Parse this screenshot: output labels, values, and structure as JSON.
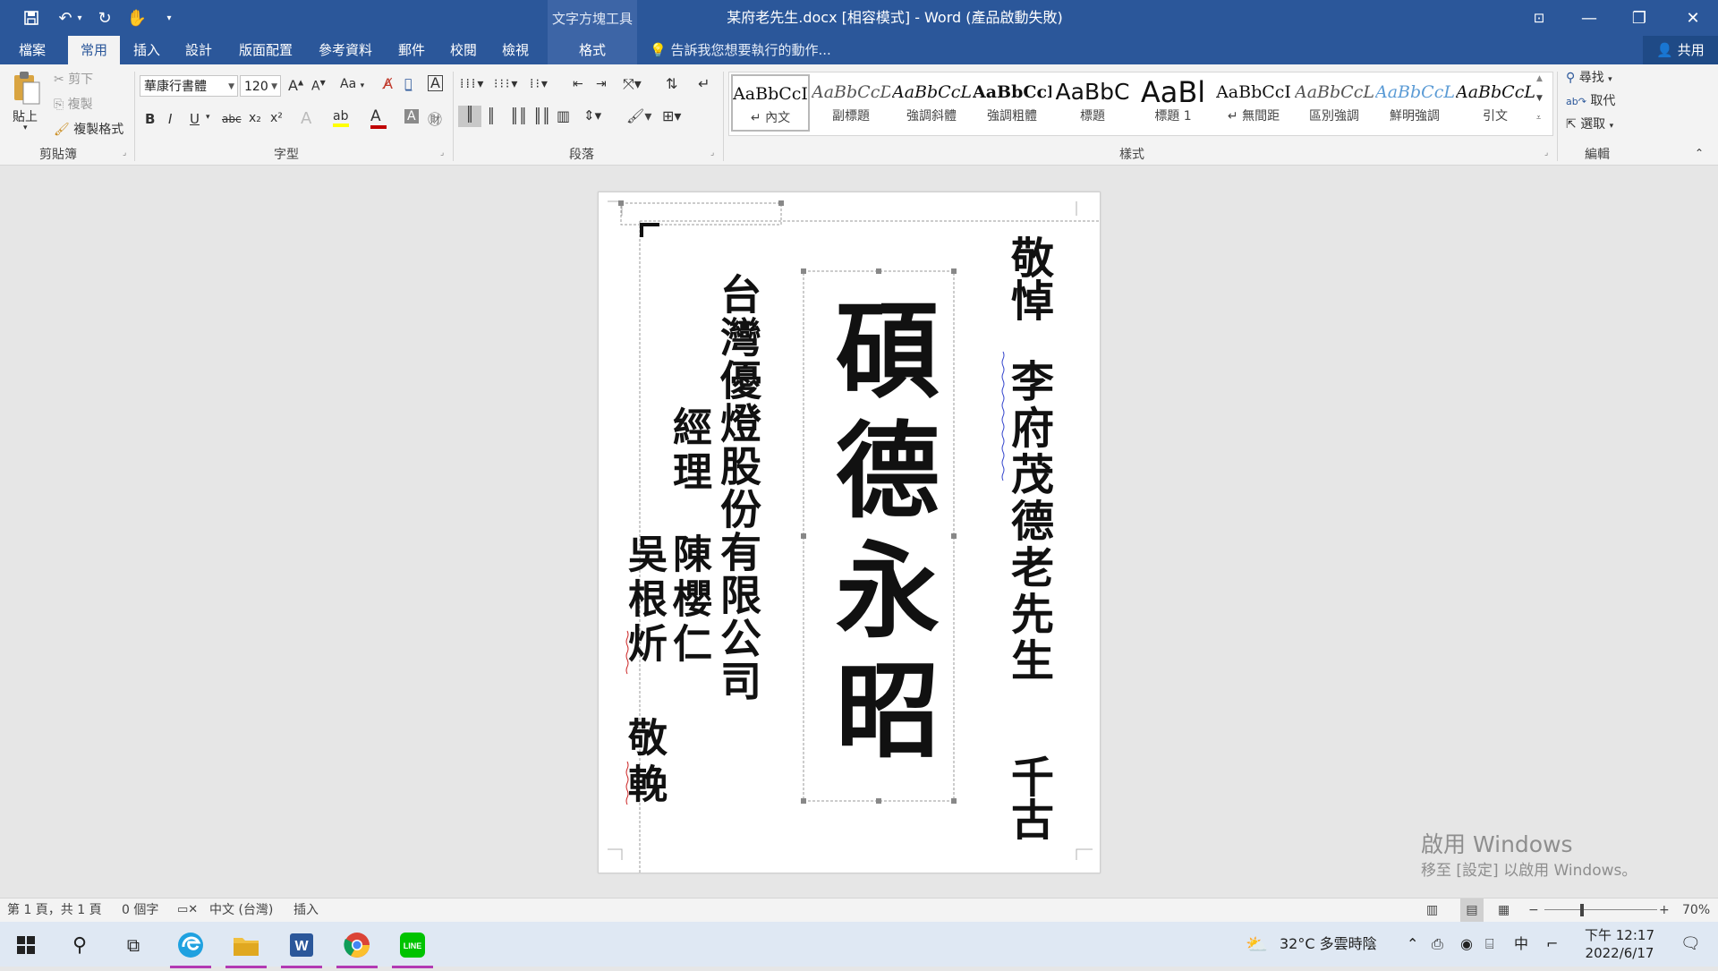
{
  "titlebar": {
    "context_tools_label": "文字方塊工具",
    "doc_title": "某府老先生.docx [相容模式] - Word (產品啟動失敗)",
    "qa_icons": [
      "save-icon",
      "undo-icon",
      "redo-icon",
      "touch-mode-icon",
      "customize-qa-icon"
    ],
    "window_buttons": {
      "ribbon_display": "⊡",
      "minimize": "—",
      "restore": "❐",
      "close": "✕"
    }
  },
  "tabs": [
    {
      "label": "檔案"
    },
    {
      "label": "常用",
      "active": true
    },
    {
      "label": "插入"
    },
    {
      "label": "設計"
    },
    {
      "label": "版面配置"
    },
    {
      "label": "參考資料"
    },
    {
      "label": "郵件"
    },
    {
      "label": "校閱"
    },
    {
      "label": "檢視"
    },
    {
      "label": "格式",
      "contextual": true
    }
  ],
  "tellme": "告訴我您想要執行的動作...",
  "share": "共用",
  "ribbon": {
    "clipboard": {
      "paste": "貼上",
      "cut": "剪下",
      "copy": "複製",
      "format_painter": "複製格式",
      "label": "剪貼簿"
    },
    "font": {
      "name": "華康行書體",
      "size": "120",
      "label": "字型",
      "bold": "B",
      "italic": "I",
      "underline": "U",
      "strike": "abc",
      "sub": "x₂",
      "sup": "x²",
      "change_case": "Aa",
      "grow": "A",
      "shrink": "A"
    },
    "paragraph": {
      "label": "段落"
    },
    "styles": {
      "label": "樣式",
      "items": [
        {
          "sample": "AaBbCcI",
          "name": "↵ 內文",
          "selected": true
        },
        {
          "sample": "AaBbCcDi",
          "name": "副標題"
        },
        {
          "sample": "AaBbCcL",
          "name": "強調斜體"
        },
        {
          "sample": "AaBbCcI",
          "name": "強調粗體"
        },
        {
          "sample": "AaBbC",
          "name": "標題"
        },
        {
          "sample": "AaBl",
          "name": "標題 1"
        },
        {
          "sample": "AaBbCcI",
          "name": "↵ 無間距"
        },
        {
          "sample": "AaBbCcL",
          "name": "區別強調"
        },
        {
          "sample": "AaBbCcL",
          "name": "鮮明強調"
        },
        {
          "sample": "AaBbCcL",
          "name": "引文"
        }
      ]
    },
    "editing": {
      "find": "尋找",
      "replace": "取代",
      "select": "選取",
      "label": "編輯"
    }
  },
  "document": {
    "col_right_top": "敬悼",
    "col_right_main": "李府茂德老先生",
    "col_right_bottom": "千古",
    "center_main": "碩德永昭",
    "col_company": "台灣優燈股份有限公司",
    "col_manager_title": "經理",
    "col_manager_name": "陳櫻仁",
    "col_sender_name": "吳根炘",
    "col_sender_closing": "敬輓"
  },
  "watermark": {
    "line1": "啟用 Windows",
    "line2": "移至 [設定] 以啟用 Windows。"
  },
  "statusbar": {
    "page": "第 1 頁，共 1 頁",
    "words": "0 個字",
    "language": "中文 (台灣)",
    "mode": "插入",
    "zoom": "70%",
    "zoom_level_pct": 70
  },
  "taskbar": {
    "weather": "32°C  多雲時陰",
    "ime": "中",
    "time_line1": "下午 12:17",
    "time_line2": "2022/6/17",
    "apps": [
      "start-icon",
      "search-icon",
      "task-view-icon",
      "edge-icon",
      "file-explorer-icon",
      "word-icon",
      "chrome-icon",
      "line-icon"
    ]
  },
  "colors": {
    "accent": "#2b579a",
    "ribbon": "#f3f3f3",
    "canvas": "#e6e6e6",
    "taskbar": "#dfe8f3"
  }
}
